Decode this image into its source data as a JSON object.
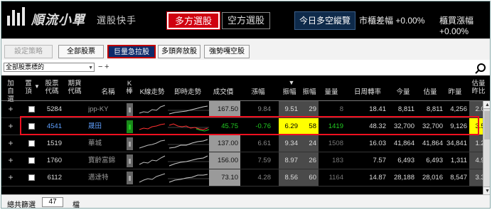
{
  "header": {
    "app_title": "順流小單",
    "app_subtitle": "選股快手",
    "mode_long": "多方選股",
    "mode_short": "空方選股",
    "market_button": "今日多空縱覽",
    "stat_listed": "市櫃差幅 +0.00%",
    "stat_otc": "櫃買漲幅 +0.00%"
  },
  "toolbar": {
    "strategy_label": "設定策略",
    "all_stocks_label": "全部股票",
    "volume_surge_label": "巨量急拉股",
    "bull_run_label": "多頭奔放股",
    "strong_short_label": "強勢嘎空股"
  },
  "filter": {
    "select_value": "全部股票標的",
    "minus_icon": "−",
    "plus_icon": "+"
  },
  "columns": {
    "add_watch": "加自選",
    "sort_watch": "置頂",
    "stock_code": "股票代碼",
    "futures_code": "期貨代碼",
    "name": "名稱",
    "k_bar": "K棒",
    "k_trend": "K線走勢",
    "intraday": "即時走勢",
    "price": "成交價",
    "change": "漲幅",
    "change_pct": "振幅",
    "amplitude": "振幅",
    "volume": "量量",
    "turnover": "日周轉率",
    "today_vol": "今量",
    "est_vol": "估量",
    "yesterday_vol": "昨量",
    "est_ratio": "估量昨比"
  },
  "rows": [
    {
      "plus": "+",
      "code": "5284",
      "futures": "",
      "name": "jpp-KY",
      "price": "167.50",
      "change": "9.84",
      "pct": "9.51",
      "amp": "29",
      "vol": "8",
      "turnover": "18.41",
      "today": "8,811",
      "est": "8,811",
      "yest": "4,256",
      "ratio": "2.07"
    },
    {
      "plus": "+",
      "code": "4541",
      "futures": "",
      "name": "晟田",
      "price": "45.75",
      "change": "-0.76",
      "pct": "6.29",
      "amp": "58",
      "vol": "1419",
      "turnover": "48.32",
      "today": "32,700",
      "est": "32,700",
      "yest": "9,126",
      "ratio": "3.58"
    },
    {
      "plus": "+",
      "code": "1519",
      "futures": "",
      "name": "華城",
      "price": "137.00",
      "change": "6.61",
      "pct": "9.34",
      "amp": "24",
      "vol": "1508",
      "turnover": "16.03",
      "today": "41,864",
      "est": "41,864",
      "yest": "34,841",
      "ratio": "1.20"
    },
    {
      "plus": "+",
      "code": "1760",
      "futures": "",
      "name": "寶齡富錦",
      "price": "156.00",
      "change": "7.59",
      "pct": "8.97",
      "amp": "26",
      "vol": "183",
      "turnover": "7.57",
      "today": "6,493",
      "est": "6,493",
      "yest": "1,311",
      "ratio": "4.95"
    },
    {
      "plus": "+",
      "code": "6112",
      "futures": "",
      "name": "邁達特",
      "price": "73.10",
      "change": "4.28",
      "pct": "8.56",
      "amp": "60",
      "vol": "1164",
      "turnover": "14.87",
      "today": "28,188",
      "est": "28,016",
      "yest": "8,547",
      "ratio": "3.30"
    }
  ],
  "footer": {
    "label": "總共篩選",
    "count": "47",
    "unit": "檔"
  },
  "colors": {
    "highlight_red": "#d00010",
    "yellow": "#ffff00",
    "navy": "#0e2a6a"
  }
}
